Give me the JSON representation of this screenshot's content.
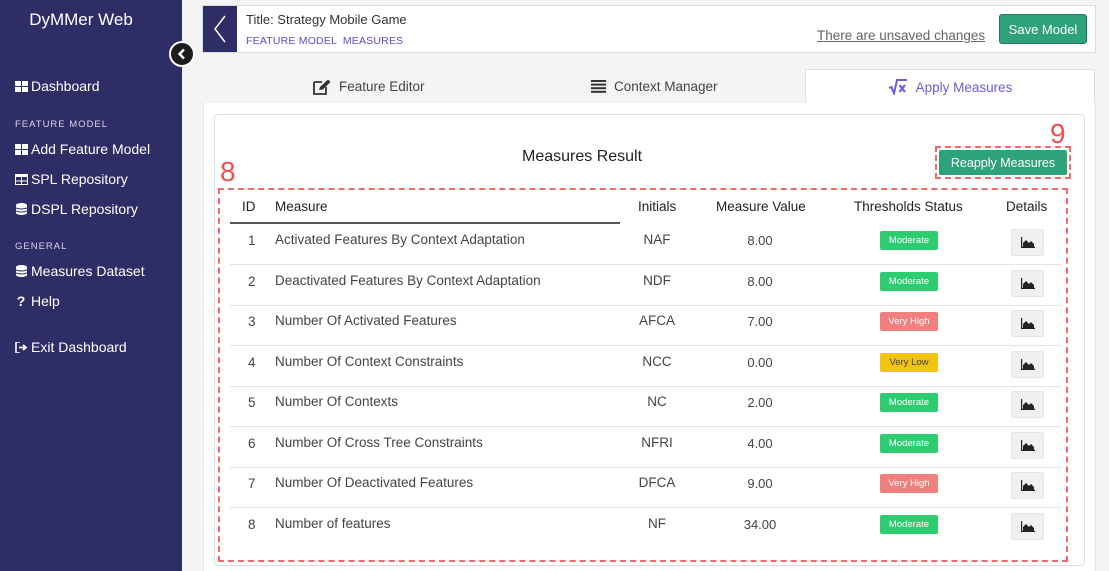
{
  "app": {
    "brand": "DyMMer Web"
  },
  "sidebar": {
    "dashboard": "Dashboard",
    "section_feature_model": "FEATURE MODEL",
    "add_feature_model": "Add Feature Model",
    "spl_repository": "SPL Repository",
    "dspl_repository": "DSPL Repository",
    "section_general": "GENERAL",
    "measures_dataset": "Measures Dataset",
    "help": "Help",
    "exit_dashboard": "Exit Dashboard"
  },
  "header": {
    "title": "Title: Strategy Mobile Game",
    "crumb_1": "FEATURE MODEL",
    "crumb_2": "MEASURES",
    "unsaved": "There are unsaved changes",
    "save_label": "Save Model"
  },
  "tabs": [
    {
      "label": "Feature Editor",
      "icon": "edit-icon"
    },
    {
      "label": "Context Manager",
      "icon": "list-icon"
    },
    {
      "label": "Apply Measures",
      "icon": "sqrt-x-icon",
      "active": true
    }
  ],
  "panel": {
    "title": "Measures Result",
    "reapply_label": "Reapply Measures",
    "marker_table": "8",
    "marker_button": "9"
  },
  "table": {
    "headers": {
      "id": "ID",
      "measure": "Measure",
      "initials": "Initials",
      "value": "Measure Value",
      "status": "Thresholds Status",
      "details": "Details"
    },
    "rows": [
      {
        "id": "1",
        "measure": "Activated Features By Context Adaptation",
        "initials": "NAF",
        "value": "8.00",
        "status": "Moderate"
      },
      {
        "id": "2",
        "measure": "Deactivated Features By Context Adaptation",
        "initials": "NDF",
        "value": "8.00",
        "status": "Moderate"
      },
      {
        "id": "3",
        "measure": "Number Of Activated Features",
        "initials": "AFCA",
        "value": "7.00",
        "status": "Very High"
      },
      {
        "id": "4",
        "measure": "Number Of Context Constraints",
        "initials": "NCC",
        "value": "0.00",
        "status": "Very Low"
      },
      {
        "id": "5",
        "measure": "Number Of Contexts",
        "initials": "NC",
        "value": "2.00",
        "status": "Moderate"
      },
      {
        "id": "6",
        "measure": "Number Of Cross Tree Constraints",
        "initials": "NFRI",
        "value": "4.00",
        "status": "Moderate"
      },
      {
        "id": "7",
        "measure": "Number Of Deactivated Features",
        "initials": "DFCA",
        "value": "9.00",
        "status": "Very High"
      },
      {
        "id": "8",
        "measure": "Number of features",
        "initials": "NF",
        "value": "34.00",
        "status": "Moderate"
      }
    ]
  },
  "colors": {
    "sidebar": "#2f2d66",
    "accent_green": "#2ea27a",
    "badge_moderate": "#2ecc71",
    "badge_very_high": "#f08080",
    "badge_very_low": "#f1c40f",
    "marker_red": "#ef4f4f",
    "tab_active": "#6a5fd6"
  }
}
